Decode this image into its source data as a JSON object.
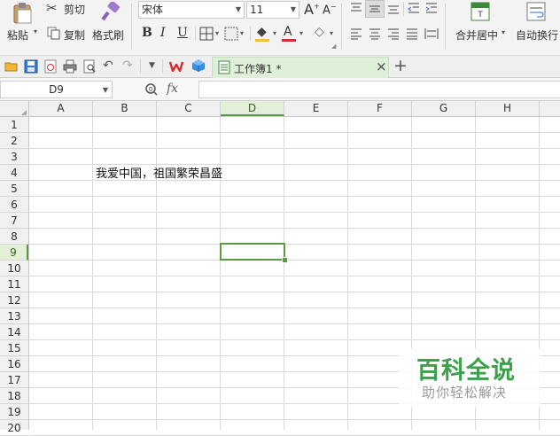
{
  "ribbon": {
    "paste_label": "粘贴",
    "cut_label": "剪切",
    "copy_label": "复制",
    "format_painter_label": "格式刷",
    "font_name": "宋体",
    "font_size": "11",
    "bold": "B",
    "italic": "I",
    "underline": "U",
    "font_color_letter": "A",
    "merge_center_label": "合并居中",
    "wrap_text_label": "自动换行",
    "colors": {
      "font_color_bar": "#d92b2b",
      "fill_color_bar": "#f2c12e"
    }
  },
  "tabbar": {
    "doc_tab_label": "工作簿1 *",
    "close_glyph": "×",
    "new_tab_glyph": "+",
    "tab_color": "#dff0d8"
  },
  "formula_bar": {
    "name_box": "D9",
    "fx_label": "fx",
    "value": ""
  },
  "sheet": {
    "columns": [
      "A",
      "B",
      "C",
      "D",
      "E",
      "F",
      "G",
      "H"
    ],
    "rows": [
      "1",
      "2",
      "3",
      "4",
      "5",
      "6",
      "7",
      "8",
      "9",
      "10",
      "11",
      "12",
      "13",
      "14",
      "15",
      "16",
      "17",
      "18",
      "19",
      "20"
    ],
    "selected_column": "D",
    "selected_row": "9",
    "cells": {
      "B4": "我爱中国，祖国繁荣昌盛"
    },
    "selection_color": "#5b9a3f"
  },
  "watermark": {
    "title": "百科全说",
    "subtitle": "助你轻松解决",
    "title_color": "#3aa04a"
  }
}
